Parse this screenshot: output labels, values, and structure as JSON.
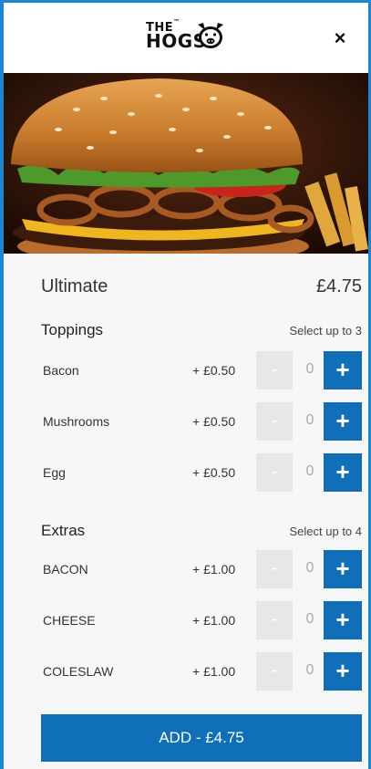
{
  "header": {
    "logo_the": "THE",
    "logo_tm": "™",
    "logo_hogs": "HOGS",
    "close_label": "×"
  },
  "hero": {
    "image_alt": "burger-photo"
  },
  "item": {
    "name": "Ultimate",
    "price": "£4.75"
  },
  "toppings": {
    "title": "Toppings",
    "note": "Select up to 3",
    "options": [
      {
        "label": "Bacon",
        "price": "+ £0.50",
        "qty": "0"
      },
      {
        "label": "Mushrooms",
        "price": "+ £0.50",
        "qty": "0"
      },
      {
        "label": "Egg",
        "price": "+ £0.50",
        "qty": "0"
      }
    ]
  },
  "extras": {
    "title": "Extras",
    "note": "Select up to 4",
    "options": [
      {
        "label": "BACON",
        "price": "+ £1.00",
        "qty": "0"
      },
      {
        "label": "CHEESE",
        "price": "+ £1.00",
        "qty": "0"
      },
      {
        "label": "COLESLAW",
        "price": "+ £1.00",
        "qty": "0"
      }
    ]
  },
  "controls": {
    "minus": "-",
    "plus": "+"
  },
  "add_button": {
    "label": "ADD - £4.75"
  },
  "colors": {
    "accent": "#0f6fb9",
    "border": "#1c86d1",
    "disabled": "#e7e7e7"
  }
}
